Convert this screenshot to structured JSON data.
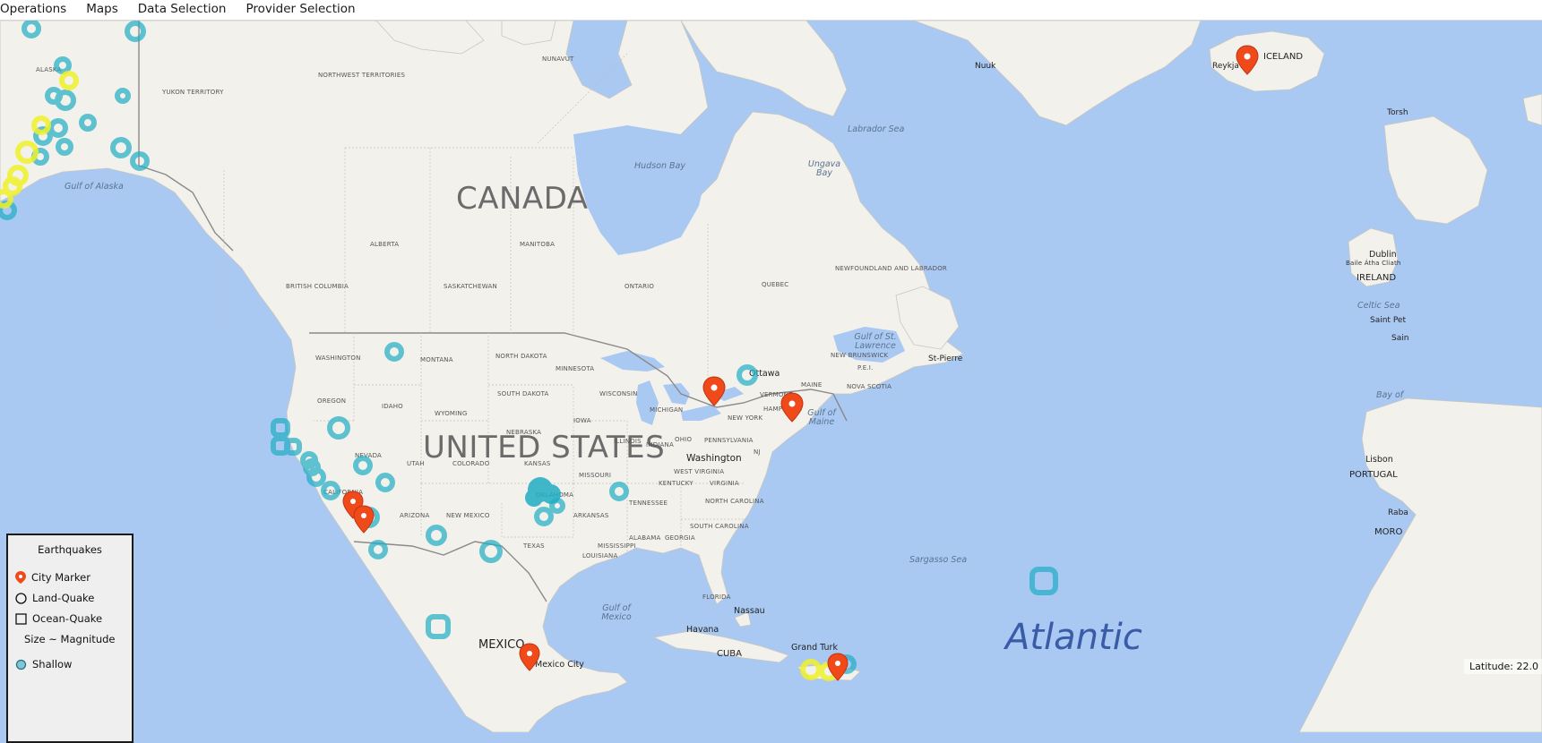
{
  "menu": [
    "Operations",
    "Maps",
    "Data Selection",
    "Provider Selection"
  ],
  "legend": {
    "title": "Earthquakes",
    "city_marker": "City Marker",
    "land_quake": "Land-Quake",
    "ocean_quake": "Ocean-Quake",
    "size_note": "Size ~ Magnitude",
    "shallow": "Shallow"
  },
  "status": {
    "latitude": "Latitude: 22.0"
  },
  "colors": {
    "water": "#a9c8f2",
    "land": "#f2f1ec",
    "quake_shallow": "#20aec4",
    "quake_mid": "#f0f22a",
    "city_marker": "#f04a1a"
  },
  "labels": {
    "canada": "CANADA",
    "united_states": "UNITED STATES",
    "mexico": "MEXICO",
    "cuba": "CUBA",
    "iceland": "ICELAND",
    "ireland": "IRELAND",
    "portugal": "PORTUGAL",
    "alaska": "ALASKA",
    "yukon": "YUKON TERRITORY",
    "nwt": "NORTHWEST TERRITORIES",
    "nunavut": "NUNAVUT",
    "bc": "BRITISH COLUMBIA",
    "alberta": "ALBERTA",
    "saskatchewan": "SASKATCHEWAN",
    "manitoba": "MANITOBA",
    "ontario": "ONTARIO",
    "quebec": "QUEBEC",
    "newfoundland": "NEWFOUNDLAND AND LABRADOR",
    "new_brunswick": "NEW BRUNSWICK",
    "pei": "P.E.I.",
    "nova_scotia": "NOVA SCOTIA",
    "washington": "WASHINGTON",
    "oregon": "OREGON",
    "idaho": "IDAHO",
    "montana": "MONTANA",
    "wyoming": "WYOMING",
    "nevada": "NEVADA",
    "utah": "UTAH",
    "colorado": "COLORADO",
    "california": "CALIFORNIA",
    "arizona": "ARIZONA",
    "new_mexico": "NEW MEXICO",
    "texas": "TEXAS",
    "north_dakota": "NORTH DAKOTA",
    "south_dakota": "SOUTH DAKOTA",
    "nebraska": "NEBRASKA",
    "kansas": "KANSAS",
    "oklahoma": "OKLAHOMA",
    "minnesota": "MINNESOTA",
    "iowa": "IOWA",
    "missouri": "MISSOURI",
    "arkansas": "ARKANSAS",
    "louisiana": "LOUISIANA",
    "mississippi": "MISSISSIPPI",
    "alabama": "ALABAMA",
    "georgia": "GEORGIA",
    "florida": "FLORIDA",
    "wisconsin": "WISCONSIN",
    "illinois": "ILLINOIS",
    "michigan": "MICHIGAN",
    "indiana": "INDIANA",
    "ohio": "OHIO",
    "kentucky": "KENTUCKY",
    "tennessee": "TENNESSEE",
    "west_virginia": "WEST VIRGINIA",
    "virginia": "VIRGINIA",
    "north_carolina": "NORTH CAROLINA",
    "south_carolina": "SOUTH CAROLINA",
    "pennsylvania": "PENNSYLVANIA",
    "new_york": "NEW YORK",
    "nj": "NJ",
    "vermont": "VERMONT",
    "hampshire": "HAMPSHIRE",
    "maine": "MAINE",
    "gulf_alaska": "Gulf of Alaska",
    "hudson_bay": "Hudson Bay",
    "ungava_bay": "Ungava Bay",
    "labrador_sea": "Labrador Sea",
    "gulf_st_lawrence": "Gulf of St. Lawrence",
    "gulf_maine": "Gulf of Maine",
    "sargasso": "Sargasso Sea",
    "gulf_mexico": "Gulf of Mexico",
    "atlantic": "Atlantic",
    "celtic_sea": "Celtic Sea",
    "bay_of": "Bay of",
    "nuuk": "Nuuk",
    "reykjavik": "Reykjavík",
    "ottawa": "Ottawa",
    "washington_dc": "Washington",
    "havana": "Havana",
    "nassau": "Nassau",
    "grand_turk": "Grand Turk",
    "mexico_city": "Mexico City",
    "dublin": "Dublin",
    "baile_atha_cliath": "Baile Átha Cliath",
    "saint_pierre": "St-Pierre",
    "lisbon": "Lisbon",
    "saint_pet": "Saint Pet",
    "saint_short": "Sain",
    "torsh": "Torsh",
    "rabat": "Raba",
    "morocco": "MORO"
  }
}
